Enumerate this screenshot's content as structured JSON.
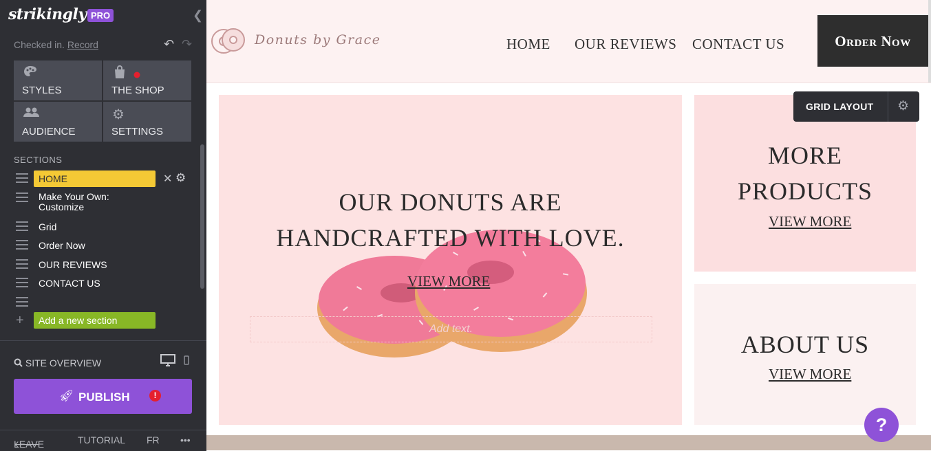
{
  "sidebar": {
    "logo": "strikingly",
    "badge": "PRO",
    "checked_in": "Checked in.",
    "record": "Record",
    "tiles": [
      {
        "label": "STYLES",
        "icon": "palette-icon"
      },
      {
        "label": "THE SHOP",
        "icon": "shopping-bag-icon"
      },
      {
        "label": "AUDIENCE",
        "icon": "people-icon"
      },
      {
        "label": "SETTINGS",
        "icon": "gear-icon"
      }
    ],
    "sections_label": "SECTIONS",
    "sections": [
      {
        "label": "HOME"
      },
      {
        "label": "Make Your Own: Customize"
      },
      {
        "label": "Grid"
      },
      {
        "label": "Order Now"
      },
      {
        "label": "OUR REVIEWS"
      },
      {
        "label": "CONTACT US"
      }
    ],
    "add_section": "Add a new section",
    "site_overview": "SITE OVERVIEW",
    "publish": "PUBLISH",
    "footer": {
      "leave": "LEAVE",
      "tutorial": "TUTORIAL",
      "lang": "FR",
      "more": "•••"
    }
  },
  "site": {
    "brand": "Donuts by Grace",
    "nav": [
      "HOME",
      "OUR REVIEWS",
      "CONTACT US"
    ],
    "order_button": "Order Now",
    "grid_layout": "GRID LAYOUT",
    "hero": {
      "line1": "OUR DONUTS ARE",
      "line2": "HANDCRAFTED WITH LOVE.",
      "link": "VIEW MORE",
      "placeholder": "Add text."
    },
    "box1": {
      "line1": "MORE",
      "line2": "PRODUCTS",
      "link": "VIEW MORE"
    },
    "box2": {
      "title": "ABOUT US",
      "link": "VIEW MORE"
    },
    "help": "?"
  },
  "colors": {
    "sidebar_bg": "#2e2f34",
    "accent_purple": "#8e52d8",
    "home_pill": "#f4c935",
    "add_section_green": "#88b726",
    "hero_bg": "#fde2e2",
    "box1_bg": "#fcdfe0",
    "box2_bg": "#fbf1f1"
  }
}
